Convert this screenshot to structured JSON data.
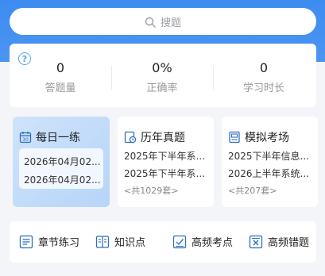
{
  "search": {
    "placeholder": "搜题",
    "icon": "search-icon"
  },
  "stats": {
    "help_icon": "help-icon",
    "items": [
      {
        "value": "0",
        "label": "答题量"
      },
      {
        "value": "0%",
        "label": "正确率"
      },
      {
        "value": "0",
        "label": "学习时长"
      }
    ]
  },
  "cards": {
    "daily": {
      "title": "每日一练",
      "icon": "calendar-icon",
      "items": [
        "2026年04月02...",
        "2026年04月02..."
      ]
    },
    "past": {
      "title": "历年真题",
      "icon": "clock-document-icon",
      "items": [
        "2025年下半年系...",
        "2025年下半年系..."
      ],
      "count": "<共1029套>"
    },
    "mock": {
      "title": "模拟考场",
      "icon": "exam-paper-icon",
      "items": [
        "2025下半年信息...",
        "2026上半年系统..."
      ],
      "count": "<共207套>"
    }
  },
  "tools": [
    {
      "label": "章节练习",
      "icon": "list-icon"
    },
    {
      "label": "知识点",
      "icon": "book-icon"
    },
    {
      "label": "高频考点",
      "icon": "check-box-icon"
    },
    {
      "label": "高频错题",
      "icon": "x-box-icon"
    }
  ],
  "colors": {
    "brand_blue": "#3d8cf0",
    "icon_blue": "#2f6fbf",
    "background": "#f3f5f9"
  }
}
